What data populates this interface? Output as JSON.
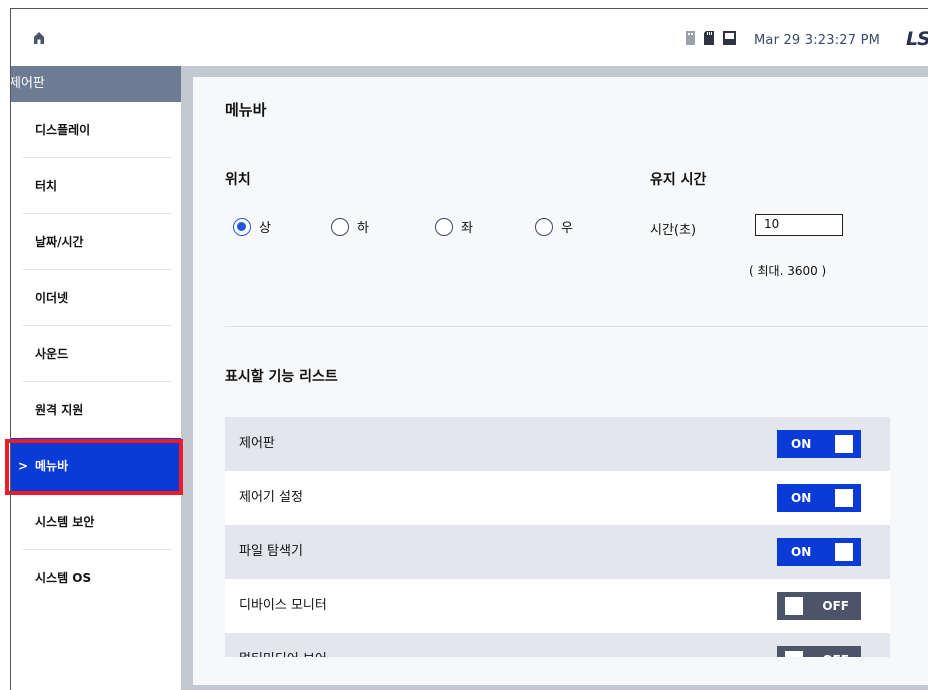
{
  "topbar": {
    "home_icon": "home-icon",
    "status_icons": [
      "usb-icon",
      "sd-card-icon",
      "storage-icon"
    ],
    "datetime": "Mar 29 3:23:27 PM",
    "logo": "LS"
  },
  "sidebar": {
    "header": "제어판",
    "items": [
      {
        "label": "디스플레이"
      },
      {
        "label": "터치"
      },
      {
        "label": "날짜/시간"
      },
      {
        "label": "이더넷"
      },
      {
        "label": "사운드"
      },
      {
        "label": "원격 지원"
      },
      {
        "label": "메뉴바",
        "active": true,
        "chevron": ">"
      },
      {
        "label": "시스템 보안"
      },
      {
        "label": "시스템 OS"
      }
    ]
  },
  "main": {
    "title": "메뉴바",
    "position": {
      "label": "위치",
      "options": [
        {
          "label": "상",
          "selected": true
        },
        {
          "label": "하",
          "selected": false
        },
        {
          "label": "좌",
          "selected": false
        },
        {
          "label": "우",
          "selected": false
        }
      ]
    },
    "hold_time": {
      "label": "유지 시간",
      "field_label": "시간(초)",
      "value": "10",
      "max_text": "( 최대. 3600 )"
    },
    "feature_list": {
      "title": "표시할 기능 리스트",
      "items": [
        {
          "label": "제어판",
          "state": "ON"
        },
        {
          "label": "제어기 설정",
          "state": "ON"
        },
        {
          "label": "파일 탐색기",
          "state": "ON"
        },
        {
          "label": "디바이스 모니터",
          "state": "OFF"
        },
        {
          "label": "멀티미디어 보어",
          "state": "OFF"
        }
      ]
    }
  },
  "colors": {
    "accent": "#0a3bd6",
    "highlight": "#ee1c24",
    "toggle_off": "#4b5468",
    "sidebar_header": "#6e7c93"
  }
}
